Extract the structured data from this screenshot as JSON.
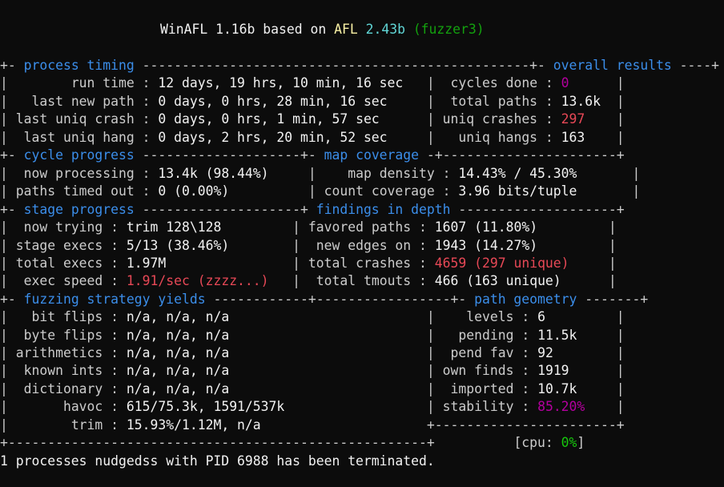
{
  "title": {
    "prefix": "WinAFL 1.16b based on ",
    "afl": "AFL",
    "afl_version": "2.43b",
    "banner": "(fuzzer3)"
  },
  "colors": {
    "background": "#0c0c0c",
    "text": "#cccccc",
    "bright": "#f2f2f2",
    "section_header": "#3b8eea",
    "afl_label": "#f9f1a5",
    "afl_version": "#61d6d6",
    "banner": "#13a10e",
    "cpu_value": "#16c60c",
    "alert": "#e74856",
    "magenta": "#b4009e"
  },
  "borders": {
    "process_timing_header": "+- ",
    "process_timing_dashes": " -------------------------------------------------+- ",
    "overall_results_dashes": " ----+",
    "cycle_progress_header": "+- ",
    "cycle_progress_dashes": " --------------------+- ",
    "map_coverage_dashes": " -+----------------------+",
    "stage_progress_header": "+- ",
    "stage_progress_dashes": " --------------------+ ",
    "findings_dashes": " --------------------+",
    "strategy_header": "+- ",
    "strategy_dashes": " ------------+-----------------+- ",
    "path_geometry_dashes": " -------+",
    "geometry_bottom": "+-----------------------+",
    "bottom": "+-----------------------------------------------------+"
  },
  "process_timing": {
    "header": "process timing",
    "run_time_label": "        run time : ",
    "run_time": "12 days, 19 hrs, 10 min, 16 sec",
    "last_new_path_label": "   last new path : ",
    "last_new_path": "0 days, 0 hrs, 28 min, 16 sec",
    "last_uniq_crash_label": " last uniq crash : ",
    "last_uniq_crash": "0 days, 0 hrs, 1 min, 57 sec",
    "last_uniq_hang_label": "  last uniq hang : ",
    "last_uniq_hang": "0 days, 2 hrs, 20 min, 52 sec"
  },
  "overall_results": {
    "header": "overall results",
    "cycles_done_label": "  cycles done : ",
    "cycles_done": "0",
    "total_paths_label": "  total paths : ",
    "total_paths": "13.6k",
    "uniq_crashes_label": " uniq crashes : ",
    "uniq_crashes": "297",
    "uniq_hangs_label": "   uniq hangs : ",
    "uniq_hangs": "163"
  },
  "cycle_progress": {
    "header": "cycle progress",
    "now_processing_label": "  now processing : ",
    "now_processing": "13.4k (98.44%)",
    "paths_timed_out_label": " paths timed out : ",
    "paths_timed_out": "0 (0.00%)"
  },
  "map_coverage": {
    "header": "map coverage",
    "map_density_label": "    map density : ",
    "map_density": "14.43% / 45.30%",
    "count_coverage_label": " count coverage : ",
    "count_coverage": "3.96 bits/tuple"
  },
  "stage_progress": {
    "header": "stage progress",
    "now_trying_label": "  now trying : ",
    "now_trying": "trim 128\\128",
    "stage_execs_label": " stage execs : ",
    "stage_execs": "5/13 (38.46%)",
    "total_execs_label": " total execs : ",
    "total_execs": "1.97M",
    "exec_speed_label": "  exec speed : ",
    "exec_speed": "1.91/sec (zzzz...)"
  },
  "findings": {
    "header": "findings in depth",
    "favored_paths_label": " favored paths : ",
    "favored_paths": "1607 (11.80%)",
    "new_edges_label": "  new edges on : ",
    "new_edges": "1943 (14.27%)",
    "total_crashes_label": " total crashes : ",
    "total_crashes": "4659 (297 unique)",
    "total_tmouts_label": "  total tmouts : ",
    "total_tmouts": "466 (163 unique)"
  },
  "strategy": {
    "header": "fuzzing strategy yields",
    "bit_flips_label": "   bit flips : ",
    "bit_flips": "n/a, n/a, n/a",
    "byte_flips_label": "  byte flips : ",
    "byte_flips": "n/a, n/a, n/a",
    "arithmetics_label": " arithmetics : ",
    "arithmetics": "n/a, n/a, n/a",
    "known_ints_label": "  known ints : ",
    "known_ints": "n/a, n/a, n/a",
    "dictionary_label": "  dictionary : ",
    "dictionary": "n/a, n/a, n/a",
    "havoc_label": "       havoc : ",
    "havoc": "615/75.3k, 1591/537k",
    "trim_label": "        trim : ",
    "trim": "15.93%/1.12M, n/a"
  },
  "path_geometry": {
    "header": "path geometry",
    "levels_label": "    levels : ",
    "levels": "6",
    "pending_label": "   pending : ",
    "pending": "11.5k",
    "pend_fav_label": "  pend fav : ",
    "pend_fav": "92",
    "own_finds_label": " own finds : ",
    "own_finds": "1919",
    "imported_label": "  imported : ",
    "imported": "10.7k",
    "stability_label": " stability : ",
    "stability": "85.20%"
  },
  "cpu": {
    "label": "[cpu: ",
    "value": "0%",
    "close": "]"
  },
  "status_message": "1 processes nudgedss with PID 6988 has been terminated."
}
